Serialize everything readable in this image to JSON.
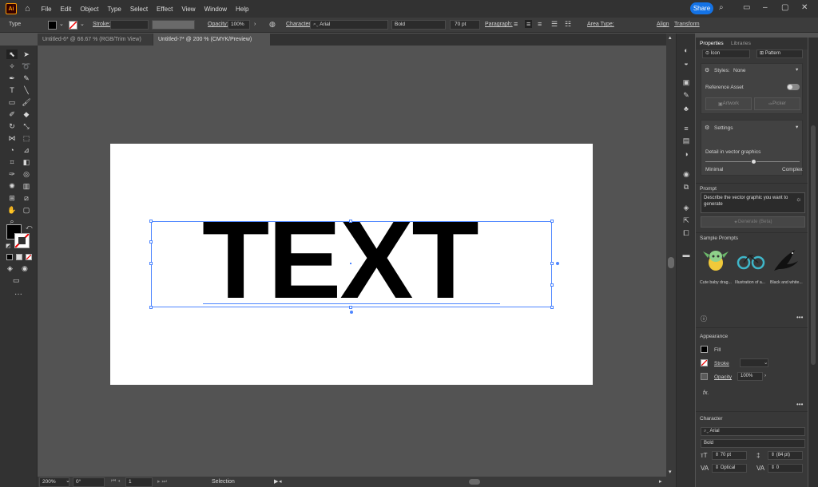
{
  "menubar": {
    "app_logo": "Ai",
    "items": [
      "File",
      "Edit",
      "Object",
      "Type",
      "Select",
      "Effect",
      "View",
      "Window",
      "Help"
    ],
    "share_label": "Share"
  },
  "control_bar": {
    "tool_name": "Type",
    "stroke_label": "Stroke:",
    "opacity_label": "Opacity:",
    "opacity_value": "100%",
    "character_label": "Character:",
    "font_family": "Arial",
    "font_style": "Bold",
    "font_size": "70 pt",
    "paragraph_label": "Paragraph:",
    "area_type_label": "Area Type:",
    "align_label": "Align",
    "transform_label": "Transform"
  },
  "tabs": [
    {
      "label": "Untitled-6* @ 66.67 % (RGB/Trim View)",
      "active": false
    },
    {
      "label": "Untitled-7* @ 200 % (CMYK/Preview)",
      "active": true
    }
  ],
  "canvas": {
    "text": "TEXT"
  },
  "status_bar": {
    "zoom": "200%",
    "rotation": "0°",
    "artboard_num": "1",
    "mode": "Selection"
  },
  "panel": {
    "tab_properties": "Properties",
    "tab_libraries": "Libraries",
    "option_icon": "Icon",
    "option_pattern": "Pattern",
    "styles_label": "Styles:",
    "styles_value": "None",
    "reference_asset": "Reference Asset",
    "artwork_btn": "Artwork",
    "picker_btn": "Picker",
    "settings_label": "Settings",
    "detail_label": "Detail in vector graphics",
    "detail_min": "Minimal",
    "detail_max": "Complex",
    "detail_value": 0.52,
    "prompt_label": "Prompt",
    "prompt_placeholder": "Describe the vector graphic you want to generate",
    "generate_btn": "Generate (Beta)",
    "sample_prompts_label": "Sample Prompts",
    "samples": [
      "Cute baby drag...",
      "Illustration of a...",
      "Black and white..."
    ],
    "appearance_label": "Appearance",
    "fill_label": "Fill",
    "stroke_label": "Stroke",
    "opacity_label": "Opacity",
    "opacity_value": "100%",
    "fx_label": "fx.",
    "character_label": "Character",
    "font_family": "Arial",
    "font_style": "Bold",
    "font_size": "70 pt",
    "leading": "(84 pt)",
    "kerning": "Optical",
    "tracking": "0"
  },
  "colors": {
    "accent": "#1473e6",
    "selection": "#4e86ff",
    "ai_brand": "#ff9a00"
  }
}
